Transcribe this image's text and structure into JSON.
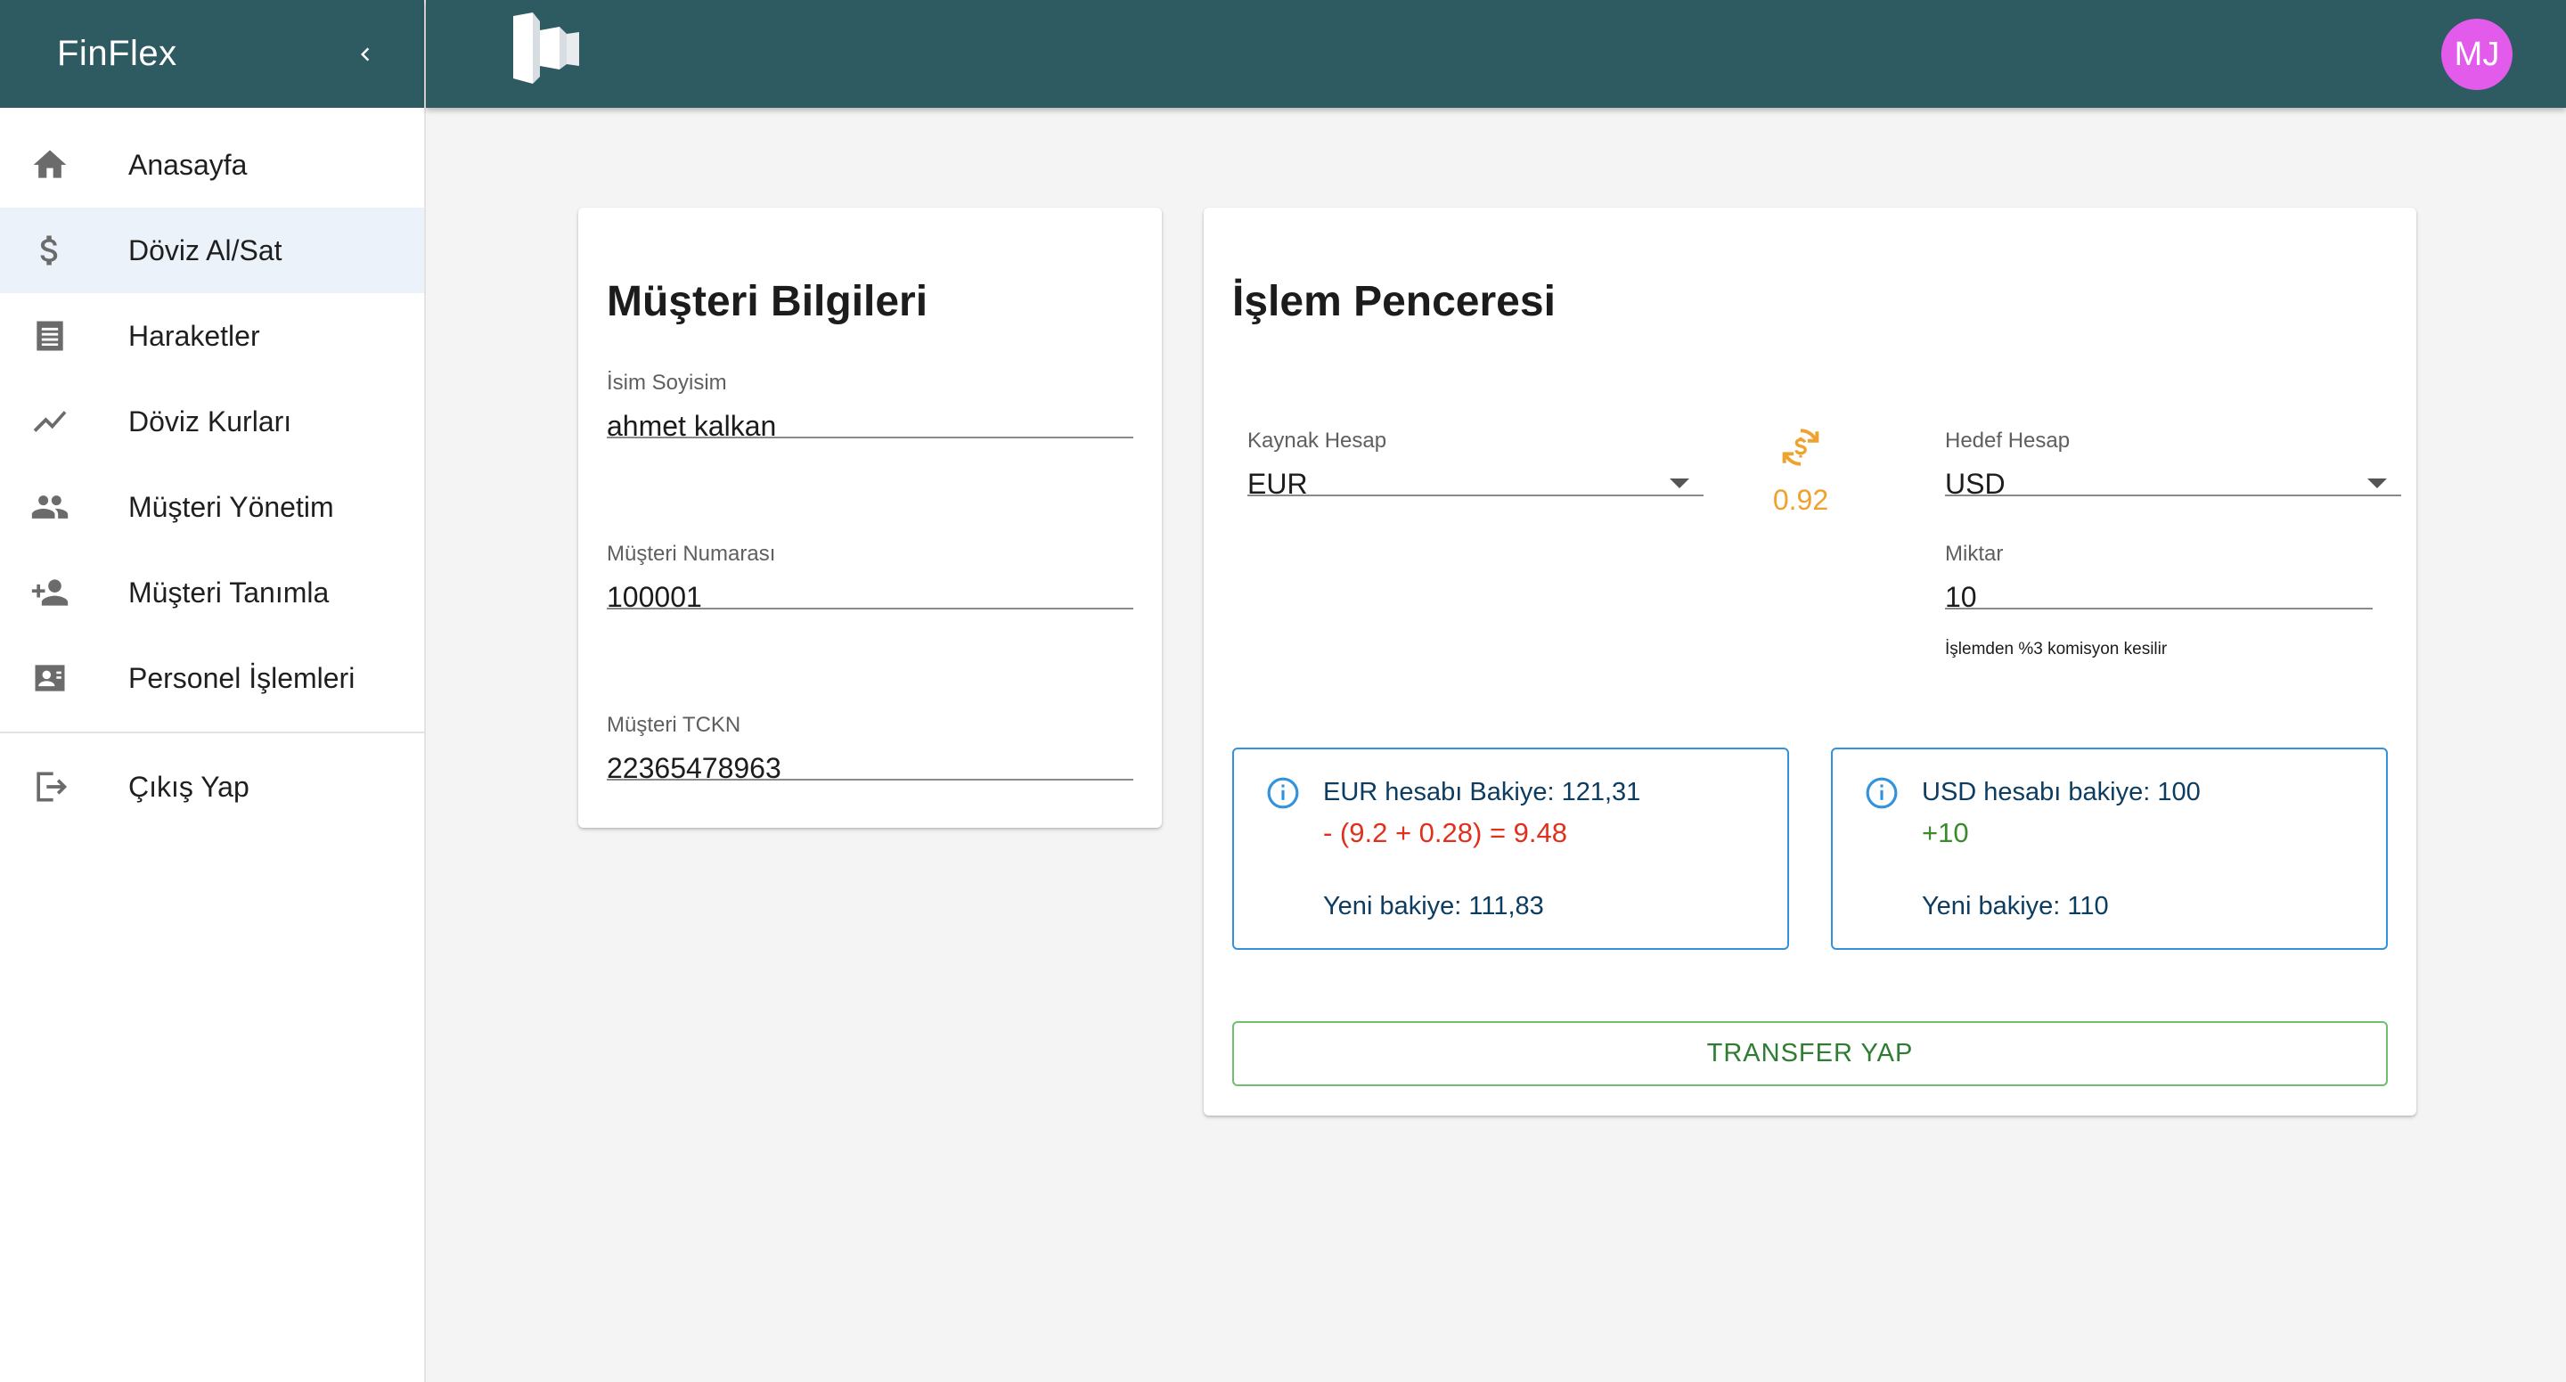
{
  "app": {
    "brand": "FinFlex",
    "avatar_initials": "MJ"
  },
  "sidebar": {
    "items": [
      {
        "label": "Anasayfa",
        "icon": "home-icon"
      },
      {
        "label": "Döviz Al/Sat",
        "icon": "dollar-icon",
        "active": true
      },
      {
        "label": "Haraketler",
        "icon": "receipt-icon"
      },
      {
        "label": "Döviz Kurları",
        "icon": "trending-icon"
      },
      {
        "label": "Müşteri Yönetim",
        "icon": "people-icon"
      },
      {
        "label": "Müşteri Tanımla",
        "icon": "person-add-icon"
      },
      {
        "label": "Personel İşlemleri",
        "icon": "badge-icon"
      }
    ],
    "logout": {
      "label": "Çıkış Yap",
      "icon": "logout-icon"
    }
  },
  "customer": {
    "title": "Müşteri Bilgileri",
    "name_label": "İsim Soyisim",
    "name_value": "ahmet kalkan",
    "number_label": "Müşteri Numarası",
    "number_value": "100001",
    "tckn_label": "Müşteri TCKN",
    "tckn_value": "22365478963"
  },
  "transaction": {
    "title": "İşlem Penceresi",
    "source_label": "Kaynak Hesap",
    "source_value": "EUR",
    "rate": "0.92",
    "target_label": "Hedef Hesap",
    "target_value": "USD",
    "amount_label": "Miktar",
    "amount_value": "10",
    "amount_helper": "İşlemden %3 komisyon kesilir",
    "source_box": {
      "line1": "EUR hesabı Bakiye: 121,31",
      "line2": "- (9.2 + 0.28) = 9.48",
      "line3": "Yeni bakiye: 111,83"
    },
    "target_box": {
      "line1": "USD hesabı bakiye: 100",
      "line2": "+10",
      "line3": "Yeni bakiye: 110"
    },
    "transfer_label": "TRANSFER YAP"
  },
  "colors": {
    "header": "#2e5a62",
    "avatar": "#e35bea",
    "rate": "#f0a22e",
    "negative": "#e0301e",
    "positive": "#3b8b2e",
    "info_text": "#0d3c61",
    "info_border": "#3392dc"
  }
}
